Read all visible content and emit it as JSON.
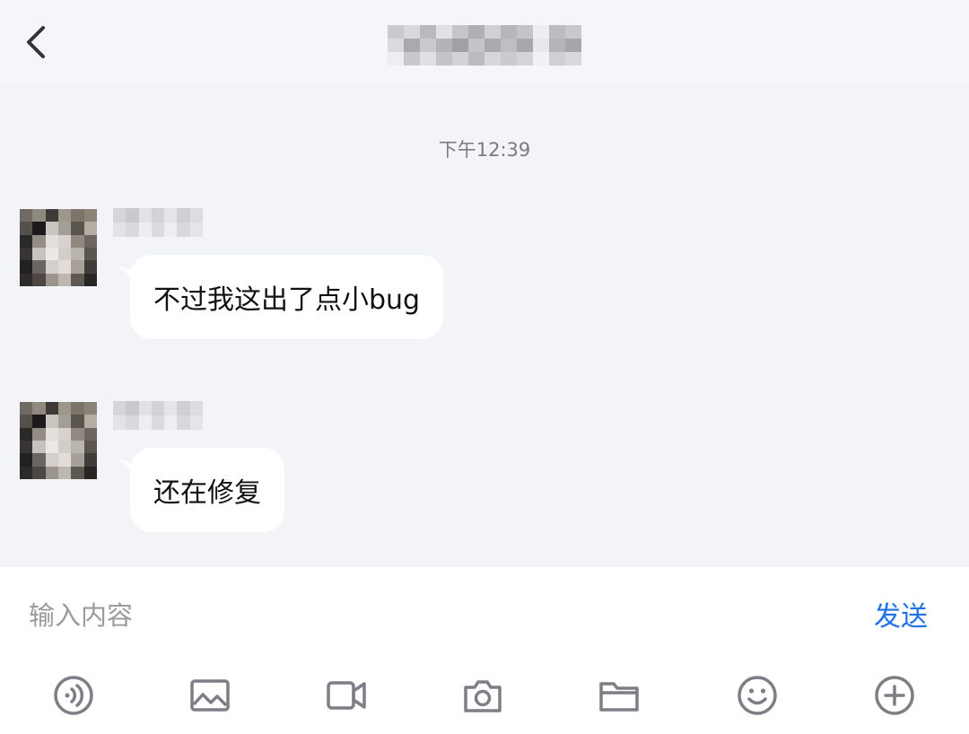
{
  "header": {
    "back_icon": "chevron-left-icon",
    "title_redacted": true
  },
  "chat": {
    "timestamp": "下午12:39",
    "messages": [
      {
        "sender_redacted": true,
        "text": "不过我这出了点小bug"
      },
      {
        "sender_redacted": true,
        "text": "还在修复"
      }
    ]
  },
  "input": {
    "placeholder": "输入内容",
    "value": "",
    "send_label": "发送"
  },
  "toolbar": {
    "icons": [
      "voice-icon",
      "image-icon",
      "video-icon",
      "camera-icon",
      "folder-icon",
      "emoji-icon",
      "plus-icon"
    ]
  },
  "colors": {
    "accent": "#1f72e8",
    "background": "#f3f4f7",
    "header": "#f5f6fb",
    "bubble": "#ffffff",
    "icon": "#7d7f86"
  }
}
